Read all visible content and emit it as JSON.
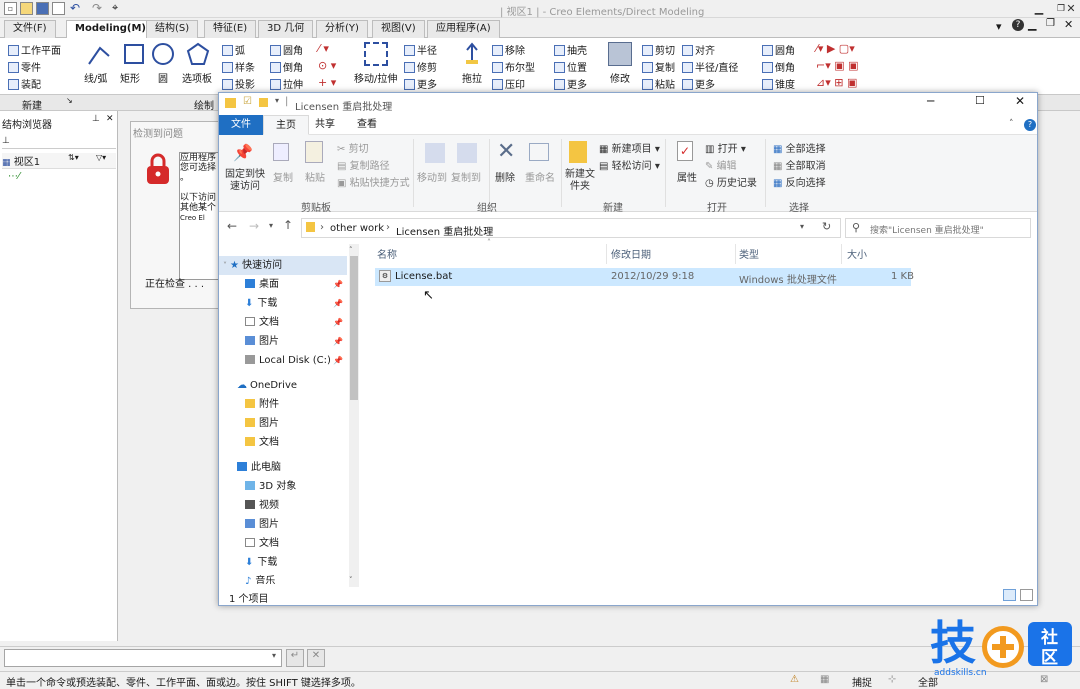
{
  "cad": {
    "window_title": "| 视区1 | - Creo Elements/Direct Modeling",
    "tabs": [
      "文件(F)",
      "Modeling(M)",
      "结构(S)",
      "特征(E)",
      "3D 几何",
      "分析(Y)",
      "视图(V)",
      "应用程序(A)"
    ],
    "active_tab": "Modeling(M)",
    "ribbon": {
      "col1": [
        "工作平面",
        "零件",
        "装配"
      ],
      "big_tools": [
        "线/弧",
        "矩形",
        "圆",
        "选项板"
      ],
      "col2": [
        "弧",
        "样条",
        "投影"
      ],
      "col3": [
        "圆角",
        "倒角",
        "拉伸"
      ],
      "move": "移动/拉伸",
      "col4": [
        "半径",
        "修剪",
        "更多"
      ],
      "pull": "拖拉",
      "col5": [
        "移除",
        "布尔型",
        "压印"
      ],
      "col6": [
        "抽壳",
        "位置",
        "更多"
      ],
      "modify": "修改",
      "col7": [
        "剪切",
        "复制",
        "粘贴"
      ],
      "col8": [
        "对齐",
        "半径/直径",
        "更多"
      ],
      "col9": [
        "圆角",
        "倒角",
        "锥度"
      ]
    },
    "group_labels": {
      "new": "新建",
      "draw": "绘制"
    },
    "structure_browser": {
      "title": "结构浏览器",
      "view_label": "视区1"
    },
    "check_dialog": {
      "title": "检测到问题",
      "lines": [
        "应用程序",
        "您可选择",
        "。",
        "以下访问",
        "其他某个",
        "Creo El"
      ],
      "status": "正在检查 . . ."
    },
    "command_input": "",
    "status_text": "单击一个命令或预选装配、零件、工作平面、面或边。按住 SHIFT 键选择多项。",
    "status_right": [
      "捕捉",
      "全部"
    ]
  },
  "explorer": {
    "title": "Licensen 重启批处理",
    "tabs": [
      "文件",
      "主页",
      "共享",
      "查看"
    ],
    "active_tab": "主页",
    "ribbon": {
      "pin": "固定到快速访问",
      "copy": "复制",
      "paste": "粘贴",
      "cut": "剪切",
      "copy_path": "复制路径",
      "paste_shortcut": "粘贴快捷方式",
      "move_to": "移动到",
      "copy_to": "复制到",
      "delete": "删除",
      "rename": "重命名",
      "new_folder": "新建文件夹",
      "new_item": "新建项目",
      "easy_access": "轻松访问",
      "properties": "属性",
      "open": "打开",
      "edit": "编辑",
      "history": "历史记录",
      "select_all": "全部选择",
      "select_none": "全部取消",
      "invert": "反向选择",
      "groups": [
        "剪贴板",
        "组织",
        "新建",
        "打开",
        "选择"
      ]
    },
    "breadcrumb": [
      "other work",
      "Licensen 重启批处理"
    ],
    "search_placeholder": "搜索\"Licensen 重启批处理\"",
    "nav": {
      "quick_access": "快速访问",
      "quick_items": [
        "桌面",
        "下载",
        "文档",
        "图片",
        "Local Disk (C:)"
      ],
      "onedrive": "OneDrive",
      "onedrive_items": [
        "附件",
        "图片",
        "文档"
      ],
      "this_pc": "此电脑",
      "pc_items": [
        "3D 对象",
        "视频",
        "图片",
        "文档",
        "下载",
        "音乐"
      ]
    },
    "columns": [
      "名称",
      "修改日期",
      "类型",
      "大小"
    ],
    "files": [
      {
        "name": "License.bat",
        "date": "2012/10/29 9:18",
        "type": "Windows 批处理文件",
        "size": "1 KB"
      }
    ],
    "item_count": "1 个项目"
  },
  "logo": {
    "char": "技",
    "side_top": "社",
    "side_bottom": "区",
    "url": "addskills.cn"
  },
  "colors": {
    "accent": "#1f6fc3",
    "selection": "#cce8ff",
    "logo_blue": "#1a73e8",
    "logo_orange": "#f29a1f"
  }
}
